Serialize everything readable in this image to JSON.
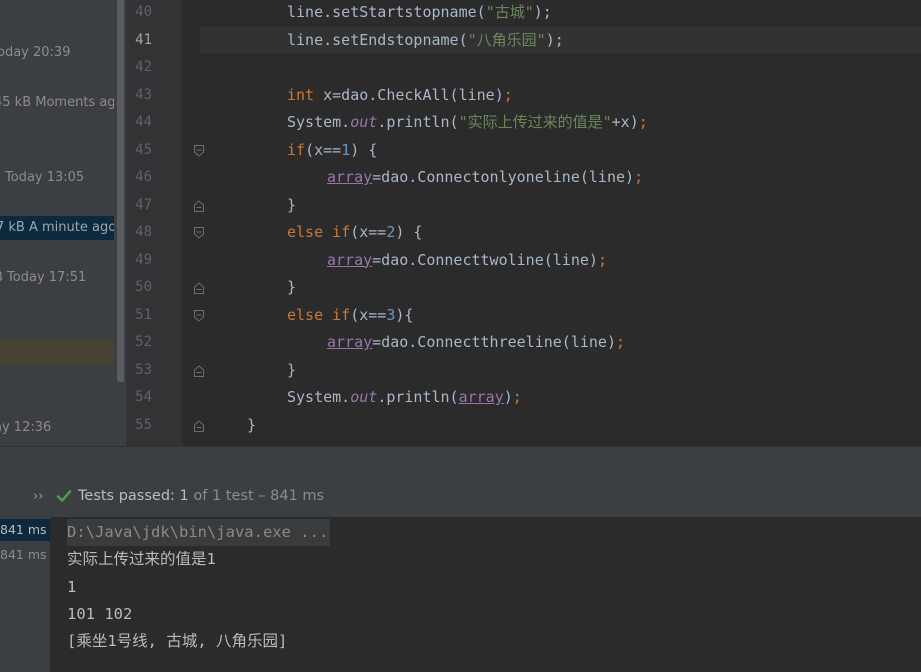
{
  "sidebar": {
    "rows": [
      {
        "text": "oday 20:39",
        "selected": false
      },
      {
        "text": "45 kB Moments ag",
        "selected": false
      },
      {
        "text": "Today 13:05",
        "selected": false
      },
      {
        "text": "7 kB A minute ago",
        "selected": true
      },
      {
        "text": "B Today 17:51",
        "selected": false
      },
      {
        "text": "ay 12:36",
        "selected": false
      }
    ]
  },
  "editor": {
    "lines": [
      {
        "n": "40",
        "indent": 2,
        "parts": [
          [
            "p",
            "line.setStartstopname("
          ],
          [
            "s",
            "\"古城\""
          ],
          [
            "p",
            ");"
          ]
        ]
      },
      {
        "n": "41",
        "indent": 2,
        "active": true,
        "parts": [
          [
            "p",
            "line.setEndstopname("
          ],
          [
            "s",
            "\"八角乐园\""
          ],
          [
            "p",
            ");"
          ]
        ]
      },
      {
        "n": "42",
        "indent": 0,
        "parts": []
      },
      {
        "n": "43",
        "indent": 2,
        "parts": [
          [
            "k",
            "int "
          ],
          [
            "p",
            "x=dao.CheckAll(line)"
          ],
          [
            "k",
            ";"
          ]
        ]
      },
      {
        "n": "44",
        "indent": 2,
        "parts": [
          [
            "p",
            "System."
          ],
          [
            "f",
            "out"
          ],
          [
            "p",
            ".println("
          ],
          [
            "s",
            "\"实际上传过来的值是\""
          ],
          [
            "p",
            "+x)"
          ],
          [
            "k",
            ";"
          ]
        ]
      },
      {
        "n": "45",
        "indent": 2,
        "fold": "open",
        "parts": [
          [
            "k",
            "if"
          ],
          [
            "p",
            "(x=="
          ],
          [
            "n",
            "1"
          ],
          [
            "p",
            ") {"
          ]
        ]
      },
      {
        "n": "46",
        "indent": 3,
        "parts": [
          [
            "v",
            "array"
          ],
          [
            "p",
            "=dao.Connectonlyoneline(line)"
          ],
          [
            "k",
            ";"
          ]
        ]
      },
      {
        "n": "47",
        "indent": 2,
        "fold": "close",
        "parts": [
          [
            "p",
            "}"
          ]
        ]
      },
      {
        "n": "48",
        "indent": 2,
        "fold": "open",
        "parts": [
          [
            "k",
            "else if"
          ],
          [
            "p",
            "(x=="
          ],
          [
            "n",
            "2"
          ],
          [
            "p",
            ") {"
          ]
        ]
      },
      {
        "n": "49",
        "indent": 3,
        "parts": [
          [
            "v",
            "array"
          ],
          [
            "p",
            "=dao.Connecttwoline(line)"
          ],
          [
            "k",
            ";"
          ]
        ]
      },
      {
        "n": "50",
        "indent": 2,
        "fold": "close",
        "parts": [
          [
            "p",
            "}"
          ]
        ]
      },
      {
        "n": "51",
        "indent": 2,
        "fold": "open",
        "parts": [
          [
            "k",
            "else if"
          ],
          [
            "p",
            "(x=="
          ],
          [
            "n",
            "3"
          ],
          [
            "p",
            "){"
          ]
        ]
      },
      {
        "n": "52",
        "indent": 3,
        "parts": [
          [
            "v",
            "array"
          ],
          [
            "p",
            "=dao.Connectthreeline(line)"
          ],
          [
            "k",
            ";"
          ]
        ]
      },
      {
        "n": "53",
        "indent": 2,
        "fold": "close",
        "parts": [
          [
            "p",
            "}"
          ]
        ]
      },
      {
        "n": "54",
        "indent": 2,
        "parts": [
          [
            "p",
            "System."
          ],
          [
            "f",
            "out"
          ],
          [
            "p",
            ".println("
          ],
          [
            "v",
            "array"
          ],
          [
            "p",
            ")"
          ],
          [
            "k",
            ";"
          ]
        ]
      },
      {
        "n": "55",
        "indent": 1,
        "fold": "close",
        "parts": [
          [
            "p",
            "}"
          ]
        ]
      }
    ]
  },
  "run_panel": {
    "status_prefix": "Tests passed:",
    "status_count": "1",
    "status_rest": "of 1 test – 841 ms",
    "check_color": "#499c54"
  },
  "test_list": [
    {
      "text": "841 ms",
      "selected": true
    },
    {
      "text": "841 ms",
      "selected": false
    }
  ],
  "console": {
    "lines": [
      "D:\\Java\\jdk\\bin\\java.exe ...",
      "实际上传过来的值是1",
      "1",
      "101 102",
      "[乘坐1号线, 古城, 八角乐园]"
    ]
  }
}
